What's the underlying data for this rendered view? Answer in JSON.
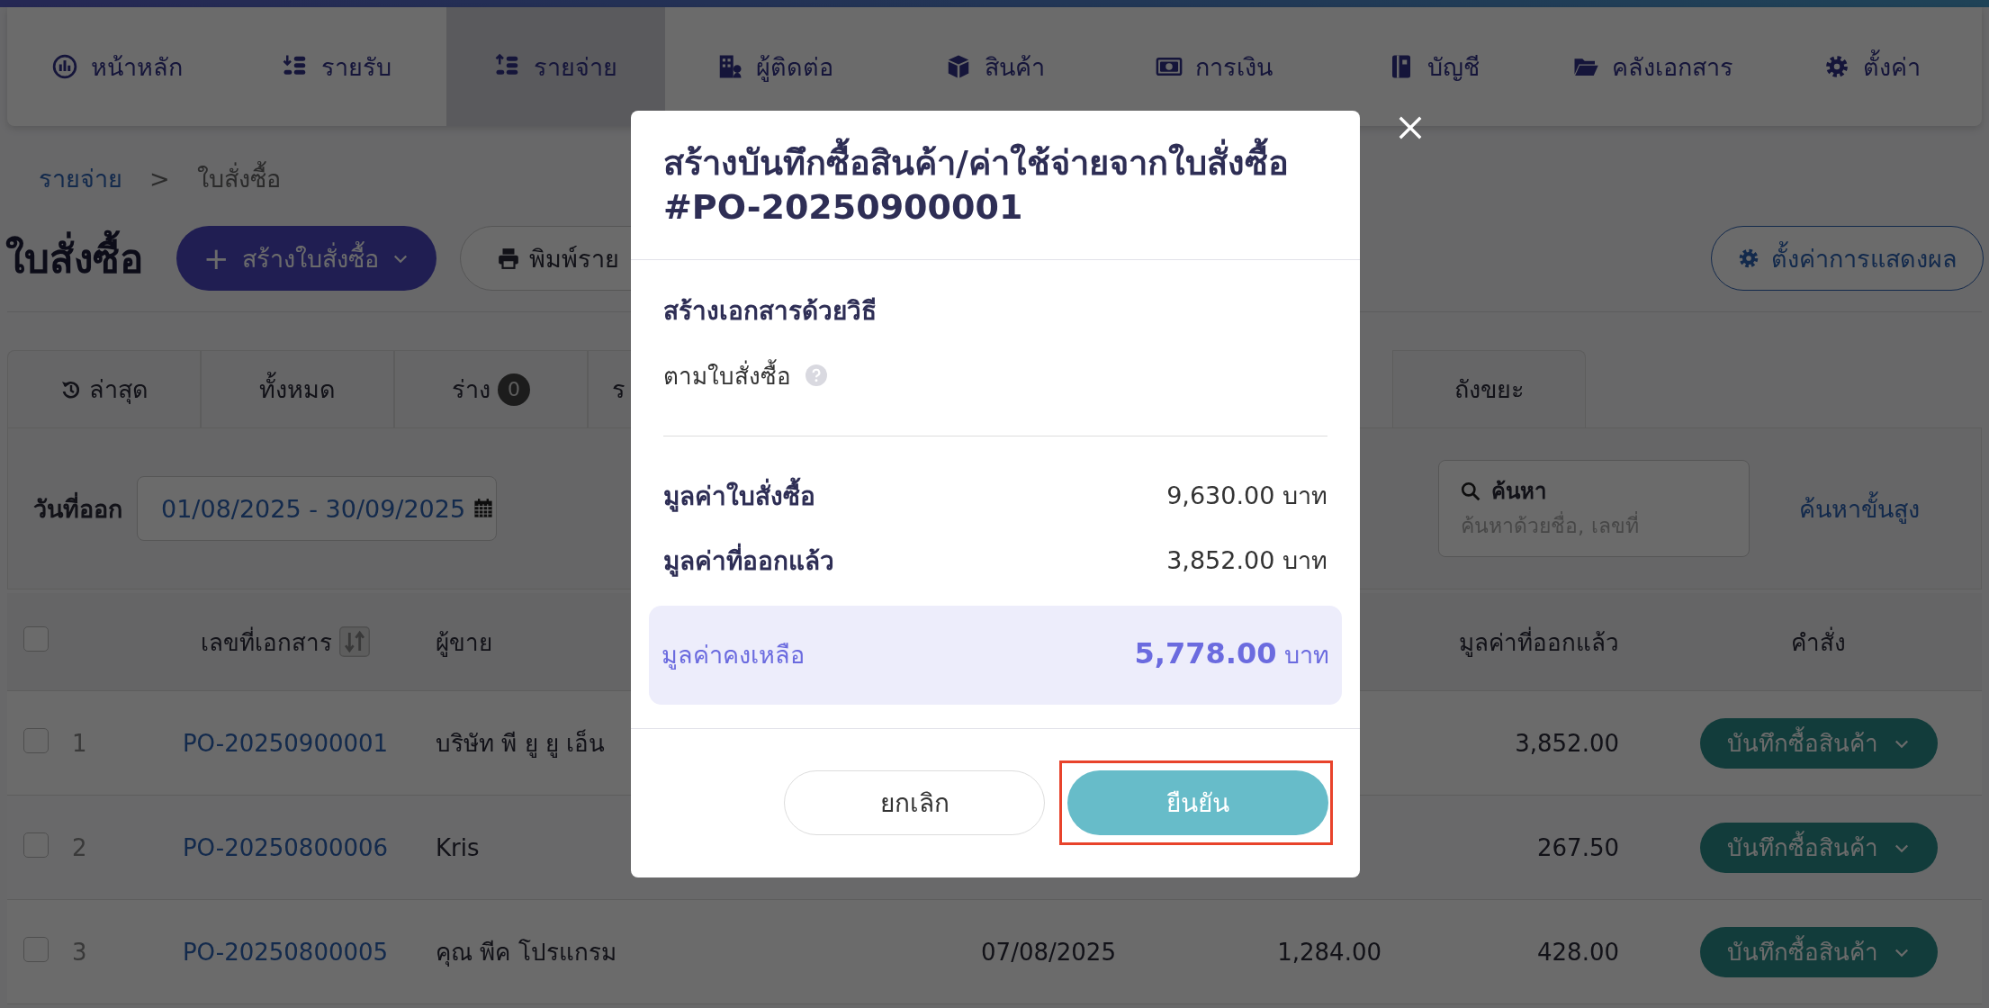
{
  "nav": [
    {
      "label": "หน้าหลัก",
      "selected": false
    },
    {
      "label": "รายรับ",
      "selected": false
    },
    {
      "label": "รายจ่าย",
      "selected": true
    },
    {
      "label": "ผู้ติดต่อ",
      "selected": false
    },
    {
      "label": "สินค้า",
      "selected": false
    },
    {
      "label": "การเงิน",
      "selected": false
    },
    {
      "label": "บัญชี",
      "selected": false
    },
    {
      "label": "คลังเอกสาร",
      "selected": false
    },
    {
      "label": "ตั้งค่า",
      "selected": false
    }
  ],
  "breadcrumb": {
    "parent": "รายจ่าย",
    "separator": ">",
    "current": "ใบสั่งซื้อ"
  },
  "page_title": "ใบสั่งซื้อ",
  "create_button": {
    "icon": "+",
    "label": "สร้างใบสั่งซื้อ"
  },
  "print_button": {
    "label": "พิมพ์ราย"
  },
  "display_settings_button": {
    "label": "ตั้งค่าการแสดงผล"
  },
  "tabs": [
    {
      "kind": "history",
      "label": "ล่าสุด",
      "selected": false
    },
    {
      "kind": "plain",
      "label": "ทั้งหมด",
      "selected": false
    },
    {
      "kind": "count",
      "label": "ร่าง",
      "count": "0",
      "selected": false
    },
    {
      "kind": "partial",
      "label": "ร",
      "selected": false
    },
    {
      "kind": "trash",
      "label": "ถังขยะ",
      "selected": false
    }
  ],
  "filter": {
    "date_label": "วันที่ออก",
    "date_range": "01/08/2025 - 30/09/2025",
    "search_label": "ค้นหา",
    "search_placeholder": "ค้นหาด้วยชื่อ, เลขที่",
    "advanced_search": "ค้นหาขั้นสูง"
  },
  "table": {
    "select_all_checked": false,
    "headers": {
      "doc_no": "เลขที่เอกสาร",
      "vendor": "ผู้ขาย",
      "issued": "มูลค่าที่ออกแล้ว",
      "action": "คำสั่ง"
    },
    "rows": [
      {
        "number": "1",
        "checked": false,
        "doc_no": "PO-20250900001",
        "vendor": "บริษัท พี ยู ยู เอ็น",
        "issued": "3,852.00",
        "action": "บันทึกซื้อสินค้า"
      },
      {
        "number": "2",
        "checked": false,
        "doc_no": "PO-20250800006",
        "vendor": "Kris",
        "issued": "267.50",
        "action": "บันทึกซื้อสินค้า"
      },
      {
        "number": "3",
        "checked": false,
        "doc_no": "PO-20250800005",
        "vendor": "คุณ พีค โปรแกรม",
        "date": "07/08/2025",
        "total": "1,284.00",
        "issued": "428.00",
        "action": "บันทึกซื้อสินค้า"
      }
    ]
  },
  "modal": {
    "title": "สร้างบันทึกซื้อสินค้า/ค่าใช้จ่ายจากใบสั่งซื้อ #PO-20250900001",
    "section_title": "สร้างเอกสารด้วยวิธี",
    "method": "ตามใบสั่งซื้อ",
    "summary": [
      {
        "label": "มูลค่าใบสั่งซื้อ",
        "amount": "9,630.00",
        "unit": "บาท"
      },
      {
        "label": "มูลค่าที่ออกแล้ว",
        "amount": "3,852.00",
        "unit": "บาท"
      }
    ],
    "remaining": {
      "label": "มูลค่าคงเหลือ",
      "amount": "5,778.00",
      "unit": "บาท"
    },
    "cancel": "ยกเลิก",
    "confirm": "ยืนยัน"
  }
}
